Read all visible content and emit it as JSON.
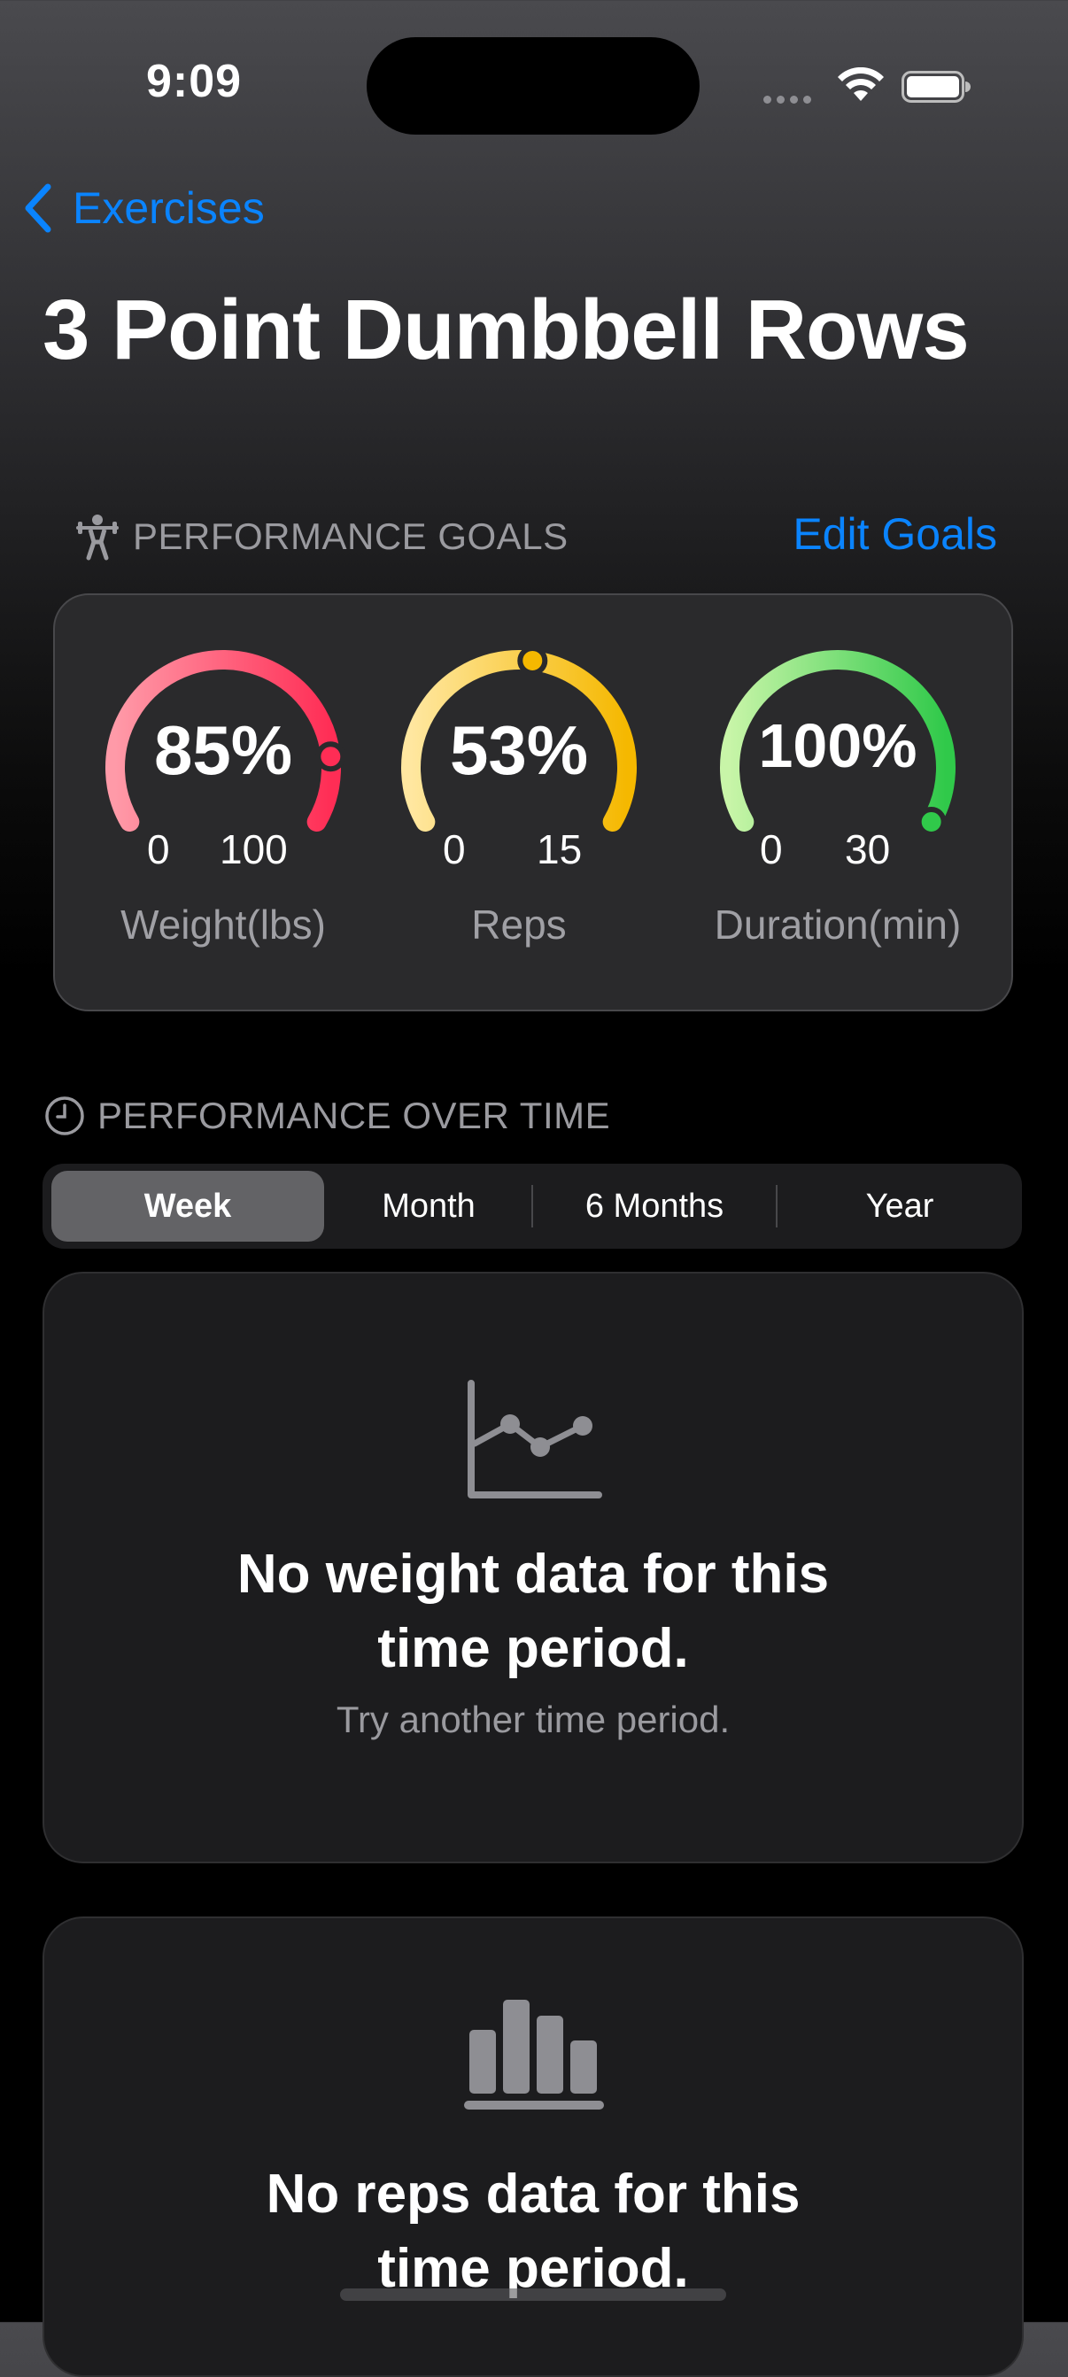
{
  "status_bar": {
    "time": "9:09"
  },
  "nav": {
    "back_label": "Exercises",
    "title": "3 Point Dumbbell Rows"
  },
  "goals": {
    "header": "PERFORMANCE GOALS",
    "edit_label": "Edit Goals",
    "gauges": [
      {
        "percent_label": "85%",
        "min": "0",
        "max": "100",
        "label": "Weight(lbs)",
        "fraction": 0.85,
        "color_start": "#ff9aa8",
        "color_end": "#ff2d55"
      },
      {
        "percent_label": "53%",
        "min": "0",
        "max": "15",
        "label": "Reps",
        "fraction": 0.53,
        "color_start": "#ffe7a0",
        "color_end": "#f5b800"
      },
      {
        "percent_label": "100%",
        "min": "0",
        "max": "30",
        "label": "Duration(min)",
        "fraction": 1.0,
        "color_start": "#c8f5a8",
        "color_end": "#30c94a"
      }
    ]
  },
  "performance": {
    "header": "PERFORMANCE OVER TIME",
    "segments": [
      "Week",
      "Month",
      "6 Months",
      "Year"
    ],
    "selected": "Week"
  },
  "cards": {
    "weight": {
      "title_line1": "No weight data for this",
      "title_line2": "time period.",
      "subtitle": "Try another time period.",
      "icon": "line-chart-icon"
    },
    "reps": {
      "title_line1": "No reps data for this",
      "title_line2": "time period.",
      "icon": "bar-chart-icon"
    }
  },
  "colors": {
    "accent": "#0a84ff",
    "card_bg": "#1c1c1e"
  }
}
